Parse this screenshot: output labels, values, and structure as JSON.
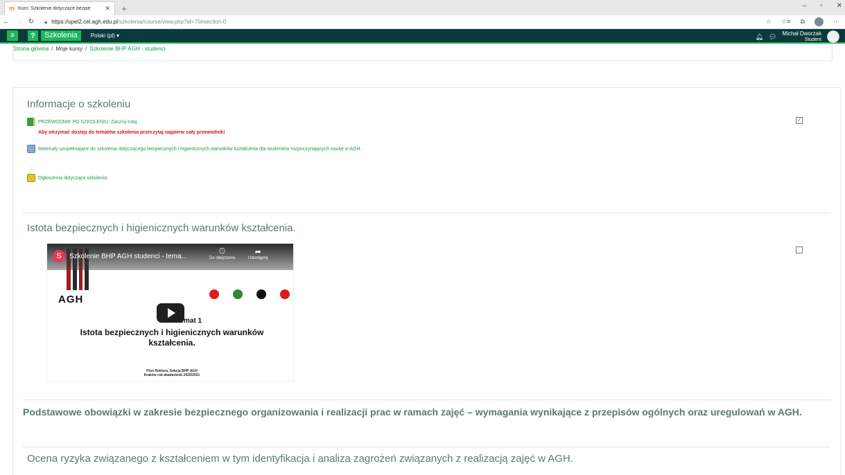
{
  "browser": {
    "tab_title": "Kurs: Szkolenie dotyczące bezpie",
    "url_host": "https://upel2.cel.agh.edu.pl",
    "url_path": "/szkolenia/course/view.php?id=70#section-0"
  },
  "navbar": {
    "brand": "Szkolenia",
    "language": "Polski (pl) ▾",
    "user_name": "Michał Dworzak",
    "user_role": "Student"
  },
  "breadcrumb": {
    "home": "Strona główna",
    "my_courses": "Moje kursy",
    "course": "Szkolenie BHP AGH - studenci"
  },
  "sections": {
    "info": {
      "title": "Informacje o szkoleniu",
      "guide_link": "PRZEWODNIK PO SZKOLENIU: Zacznij tutaj",
      "warning": "Aby otrzymać dostęp do tematów szkolenia przeczytaj najpierw cały przewodnik!",
      "materials_link": "Materiały uzupełniające do szkolenia dotyczącego bezpiecznych i higienicznych warunków kształcenia dla studentów rozpoczynających naukę w AGH.",
      "announcements_link": "Ogłoszenia dotyczące szkolenia"
    },
    "topic1": {
      "title": "Istota bezpiecznych i higienicznych warunków kształcenia.",
      "video": {
        "channel_initial": "S",
        "title": "Szkolenie BHP AGH studenci - tema...",
        "watch_later": "Do obejrzenia",
        "share": "Udostępnij",
        "logo_text": "AGH",
        "temat": "Temat 1",
        "heading": "Istota bezpiecznych i higienicznych warunków kształcenia.",
        "footer_line1": "Pion Rektora, Sekcja BHP AGH",
        "footer_line2": "Kraków rok akademicki 2020/2021"
      }
    },
    "topic2": {
      "title": "Podstawowe obowiązki w zakresie bezpiecznego organizowania i realizacji prac w ramach zajęć – wymagania wynikające z przepisów ogólnych oraz uregulowań w AGH."
    },
    "topic3": {
      "title": "Ocena ryzyka związanego z kształceniem w tym identyfikacja i analiza zagrożeń związanych z realizacją zajęć w AGH."
    }
  },
  "colors": {
    "navbar_bg": "#0b3a3a",
    "accent_green": "#1ab85b",
    "link_green": "#1a9a52",
    "warning_red": "#d9120c"
  }
}
